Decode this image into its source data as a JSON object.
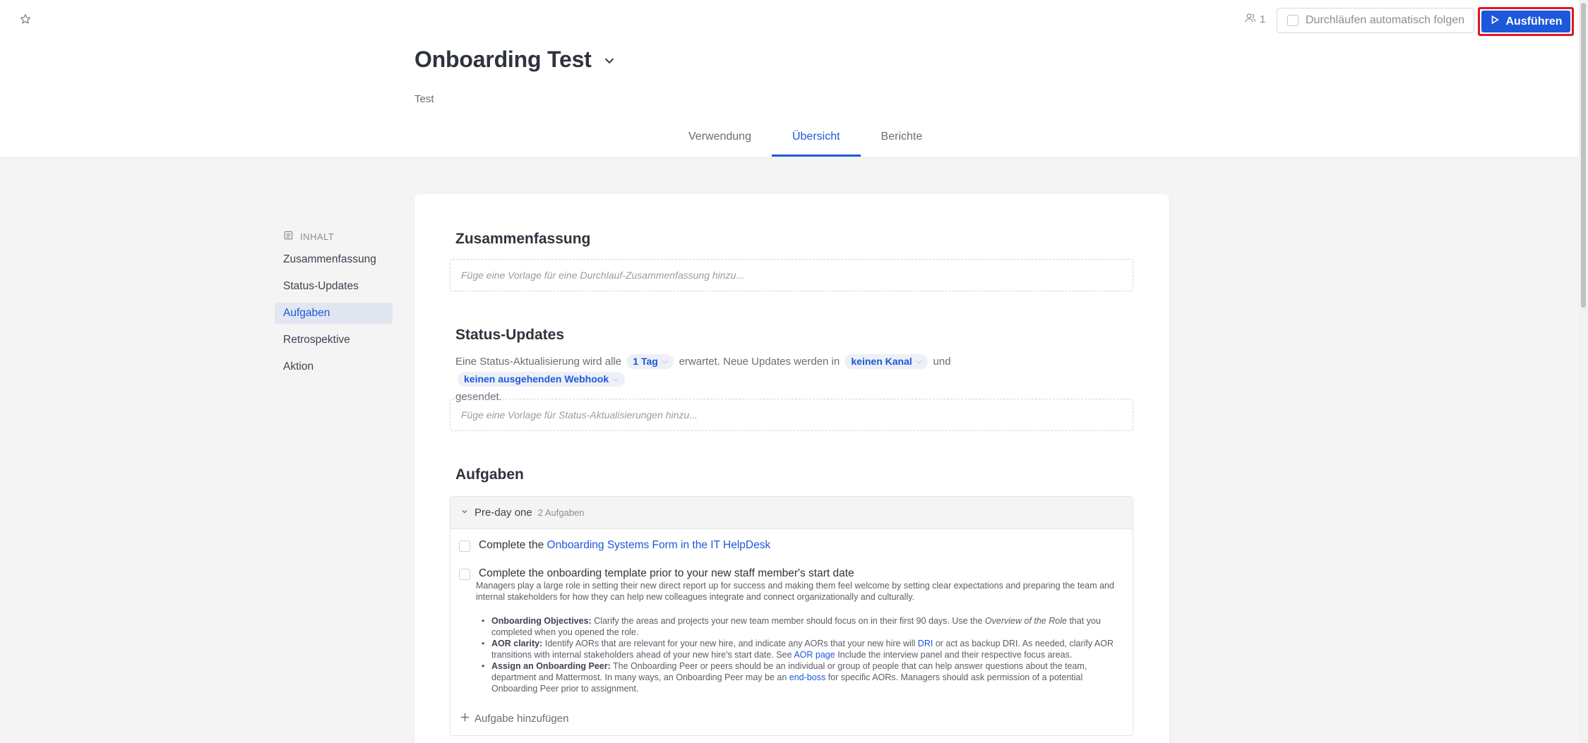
{
  "header": {
    "participants_count": "1",
    "follow_label": "Durchläufen automatisch folgen",
    "run_label": "Ausführen",
    "title": "Onboarding Test",
    "description": "Test"
  },
  "tabs": [
    {
      "label": "Verwendung",
      "active": false
    },
    {
      "label": "Übersicht",
      "active": true
    },
    {
      "label": "Berichte",
      "active": false
    }
  ],
  "toc": {
    "heading": "INHALT",
    "items": [
      {
        "label": "Zusammenfassung",
        "active": false
      },
      {
        "label": "Status-Updates",
        "active": false
      },
      {
        "label": "Aufgaben",
        "active": true
      },
      {
        "label": "Retrospektive",
        "active": false
      },
      {
        "label": "Aktion",
        "active": false
      }
    ]
  },
  "summary": {
    "title": "Zusammenfassung",
    "placeholder": "Füge eine Vorlage für eine Durchlauf-Zusammenfassung hinzu..."
  },
  "status_updates": {
    "title": "Status-Updates",
    "text_1": "Eine Status-Aktualisierung wird alle",
    "interval": "1 Tag",
    "text_2": "erwartet. Neue Updates werden in",
    "channel": "keinen Kanal",
    "text_3": "und",
    "webhook": "keinen ausgehenden Webhook",
    "text_4": "gesendet.",
    "placeholder": "Füge eine Vorlage für Status-Aktualisierungen hinzu..."
  },
  "tasks": {
    "title": "Aufgaben",
    "group_name": "Pre-day one",
    "group_count": "2 Aufgaben",
    "task1_prefix": "Complete the",
    "task1_link": "Onboarding Systems Form in the IT HelpDesk",
    "task2_title": "Complete the onboarding template prior to your new staff member's start date",
    "task2_desc": "Managers play a large role in setting their new direct report up for success and making them feel welcome by setting clear expectations and preparing the team and internal stakeholders for how they can help new colleagues integrate and connect organizationally and culturally.",
    "b1_label": "Onboarding Objectives:",
    "b1_text_a": "Clarify the areas and projects your new team member should focus on in their first 90 days. Use the",
    "b1_em": "Overview of the Role",
    "b1_text_b": "that you completed when you opened the role.",
    "b2_label": "AOR clarity:",
    "b2_text_a": "Identify AORs that are relevant for your new hire, and indicate any AORs that your new hire will",
    "b2_link1": "DRI",
    "b2_text_b": "or act as backup DRI. As needed, clarify AOR transitions with internal stakeholders ahead of your new hire's start date. See",
    "b2_link2": "AOR page",
    "b2_text_c": "Include the interview panel and their respective focus areas.",
    "b3_label": "Assign an Onboarding Peer:",
    "b3_text_a": "The Onboarding Peer or peers should be an individual or group of people that can help answer questions about the team, department and Mattermost. In many ways, an Onboarding Peer may be an",
    "b3_link": "end-boss",
    "b3_text_b": "for specific AORs. Managers should ask permission of a potential Onboarding Peer prior to assignment.",
    "add_label": "Aufgabe hinzufügen"
  }
}
